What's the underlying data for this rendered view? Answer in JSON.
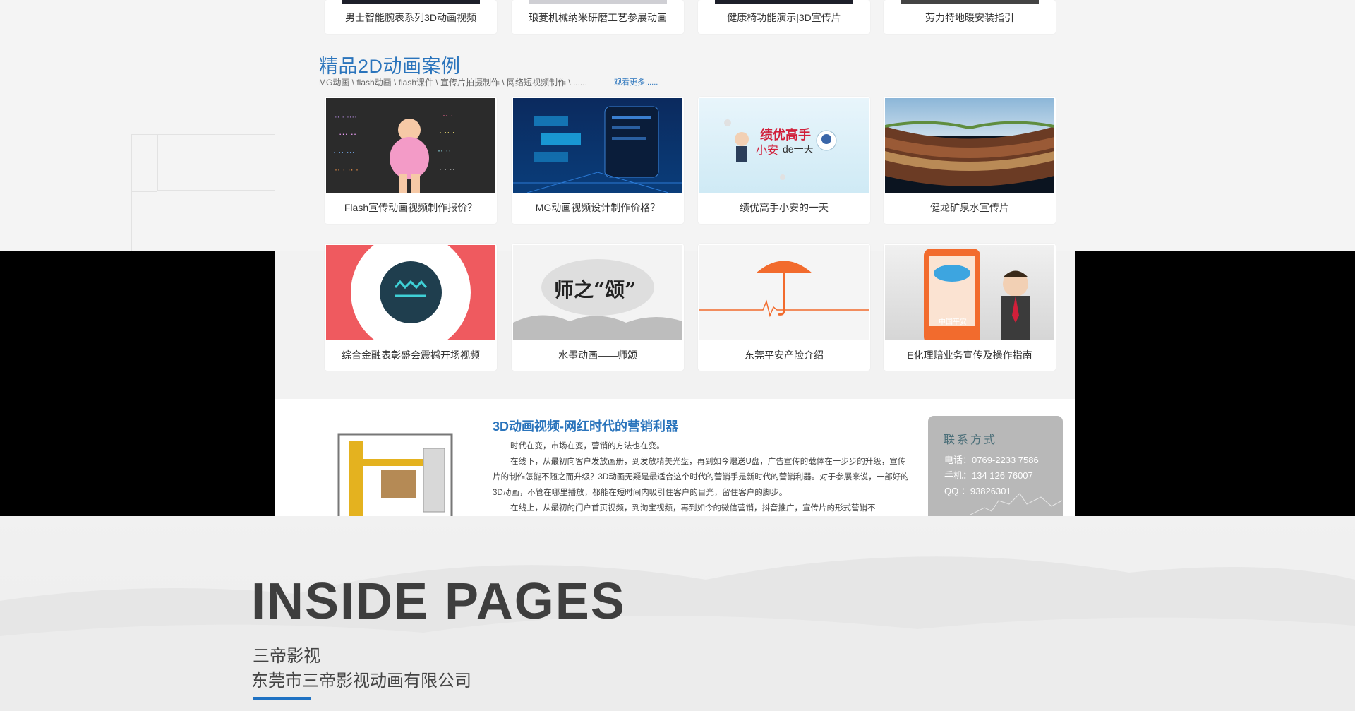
{
  "top_row": [
    {
      "caption": "男士智能腕表系列3D动画视频"
    },
    {
      "caption": "琅菱机械纳米研磨工艺参展动画"
    },
    {
      "caption": "健康椅功能演示|3D宣传片"
    },
    {
      "caption": "劳力特地暖安装指引"
    }
  ],
  "section": {
    "title": "精品2D动画案例",
    "subtitle": "MG动画 \\ flash动画 \\ flash课件 \\ 宣传片拍摄制作 \\ 网络短视频制作 \\ ......",
    "more": "观看更多......"
  },
  "row1": [
    {
      "caption": "Flash宣传动画视频制作报价？",
      "thumb": "doodle-woman"
    },
    {
      "caption": "MG动画视频设计制作价格？",
      "thumb": "tech-blue"
    },
    {
      "caption": "绩优高手小安的一天",
      "thumb": "cartoon-robot",
      "overlay1": "绩优高手",
      "overlay2": "小安",
      "overlay3": "de一天"
    },
    {
      "caption": "健龙矿泉水宣传片",
      "thumb": "earth-layers"
    }
  ],
  "row2": [
    {
      "caption": "综合金融表彰盛会震撼开场视频",
      "thumb": "red-logo"
    },
    {
      "caption": "水墨动画——师颂",
      "thumb": "ink",
      "overlay1": "师之“颂”"
    },
    {
      "caption": "东莞平安产险介绍",
      "thumb": "umbrella"
    },
    {
      "caption": "E化理赔业务宣传及操作指南",
      "thumb": "phone-man",
      "overlay1": "中国平安"
    }
  ],
  "article": {
    "title": "3D动画视频-网红时代的营销利器",
    "p1": "时代在变，市场在变，营销的方法也在变。",
    "p2": "在线下，从最初向客户发放画册，到发放精美光盘，再到如今赠送U盘，广告宣传的载体在一步步的升级，宣传片的制作怎能不随之而升级？3D动画无疑是最适合这个时代的营销手是新时代的营销利器。对于参展来说，一部好的3D动画，不管在哪里播放，都能在短时间内吸引住客户的目光，留住客户的脚步。",
    "p3": "在线上，从最初的门户首页视频，到淘宝视频，再到如今的微信营销，抖音推广，宣传片的形式营销不"
  },
  "contact": {
    "title": "联系方式",
    "phone": "电话：0769-2233 7586",
    "mobile": "手机：134 126 76007",
    "qq": "QQ ：93826301"
  },
  "footer": {
    "title": "INSIDE PAGES",
    "company_short": "三帝影视",
    "company_full": "东莞市三帝影视动画有限公司"
  },
  "colors": {
    "accent": "#2a74bc",
    "bar": "#1f72c3",
    "band": "#000000"
  }
}
